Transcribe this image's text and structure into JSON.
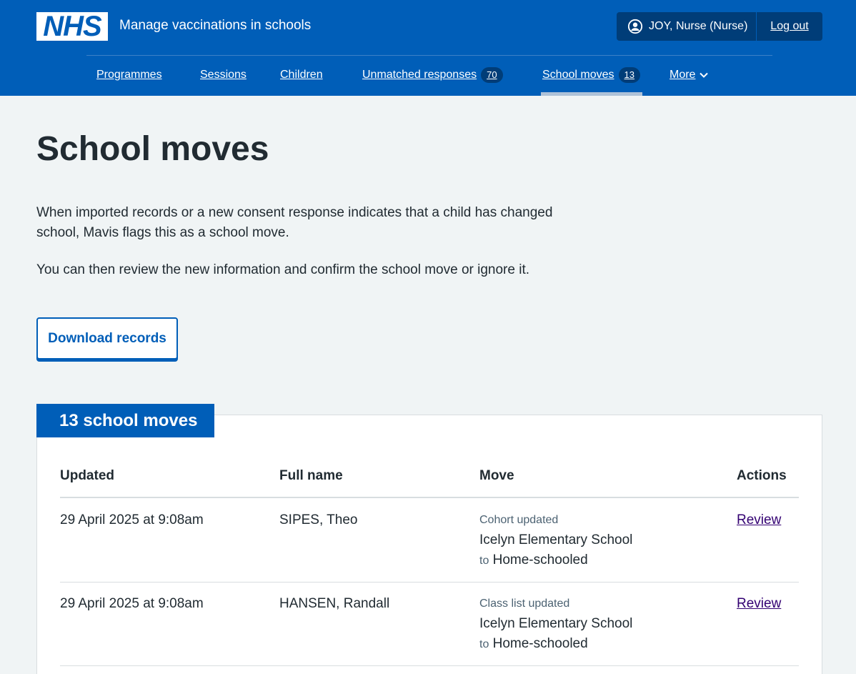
{
  "header": {
    "logo_text": "NHS",
    "service_name": "Manage vaccinations in schools",
    "account_user": "JOY, Nurse (Nurse)",
    "logout_label": "Log out"
  },
  "nav": {
    "items": [
      {
        "label": "Programmes"
      },
      {
        "label": "Sessions"
      },
      {
        "label": "Children"
      },
      {
        "label": "Unmatched responses",
        "count": "70"
      },
      {
        "label": "School moves",
        "count": "13",
        "active": true
      },
      {
        "label": "More"
      }
    ]
  },
  "page": {
    "title": "School moves",
    "para1": "When imported records or a new consent response indicates that a child has changed school, Mavis flags this as a school move.",
    "para2": "You can then review the new information and confirm the school move or ignore it.",
    "download_label": "Download records"
  },
  "table": {
    "heading": "13 school moves",
    "columns": [
      "Updated",
      "Full name",
      "Move",
      "Actions"
    ],
    "rows": [
      {
        "updated": "29 April 2025 at 9:08am",
        "name": "SIPES, Theo",
        "move_label": "Cohort updated",
        "from": "Icelyn Elementary School",
        "to_word": "to",
        "to": "Home-schooled",
        "action": "Review"
      },
      {
        "updated": "29 April 2025 at 9:08am",
        "name": "HANSEN, Randall",
        "move_label": "Class list updated",
        "from": "Icelyn Elementary School",
        "to_word": "to",
        "to": "Home-schooled",
        "action": "Review"
      }
    ]
  },
  "colors": {
    "brand": "#005eb8",
    "brand_dark": "#003d78",
    "link_visited": "#330072",
    "background": "#f0f4f5"
  }
}
